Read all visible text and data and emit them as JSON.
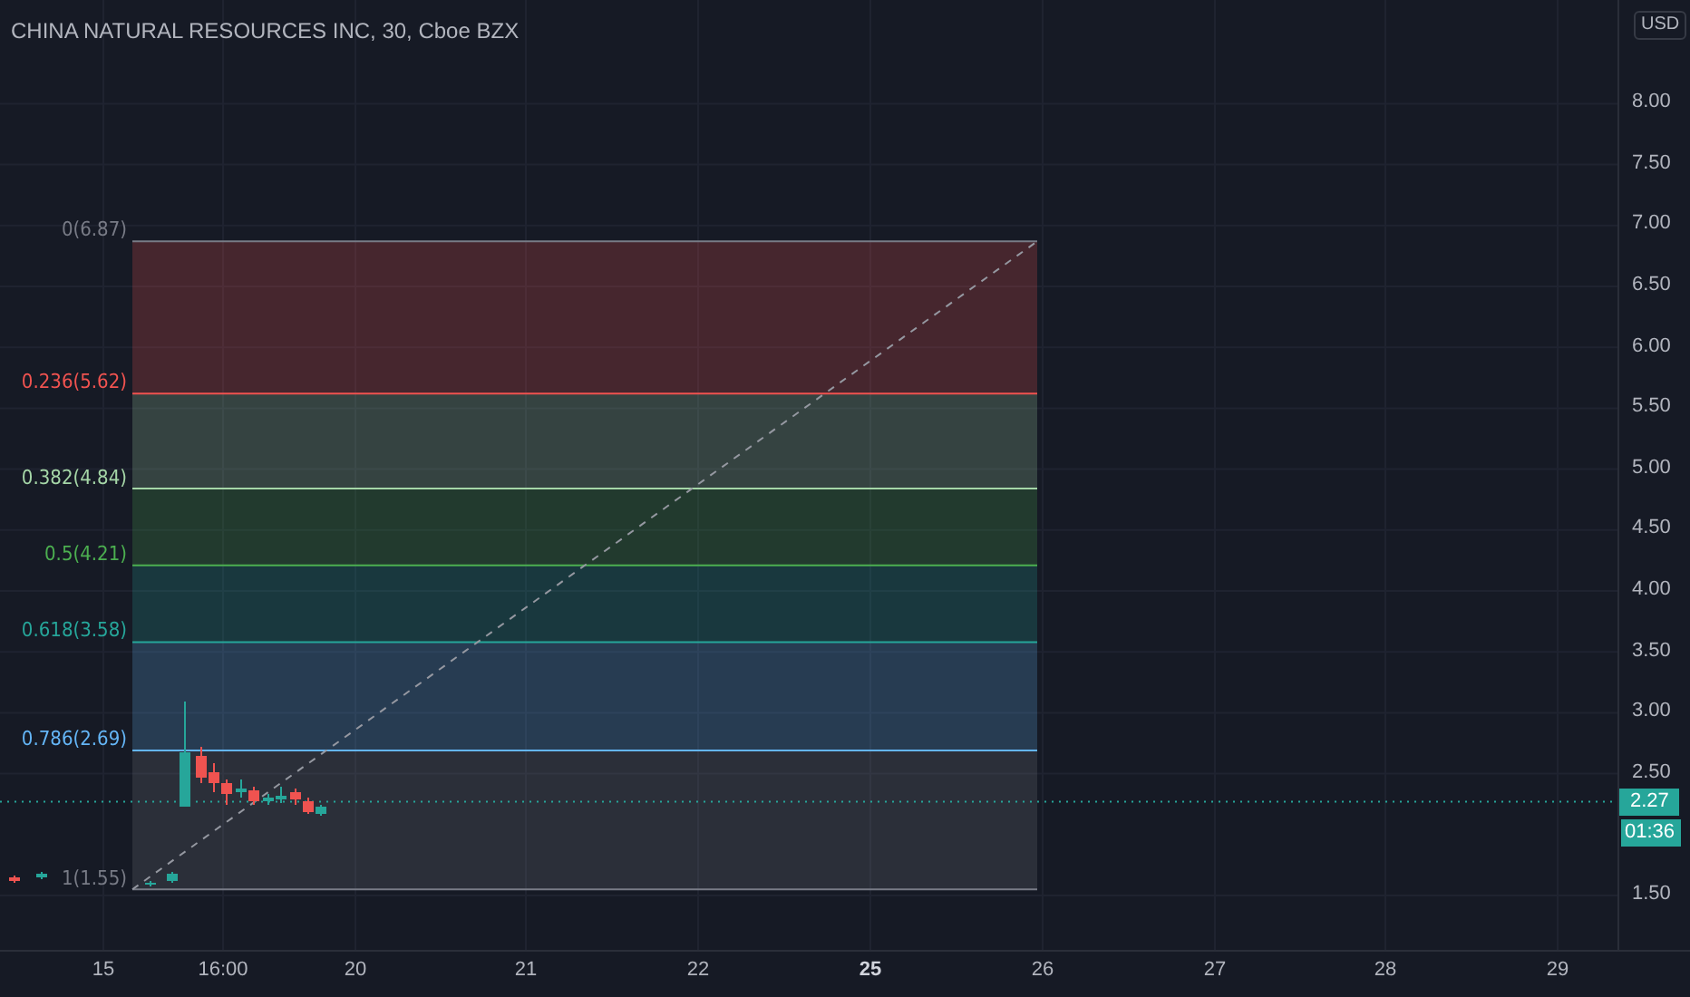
{
  "header": {
    "title": "CHINA NATURAL RESOURCES INC, 30, Cboe BZX"
  },
  "currency_button": {
    "label": "USD"
  },
  "price_axis": {
    "ticks": [
      "8.00",
      "7.50",
      "7.00",
      "6.50",
      "6.00",
      "5.50",
      "5.00",
      "4.50",
      "4.00",
      "3.50",
      "3.00",
      "2.50",
      "1.50"
    ]
  },
  "price_marker": {
    "last_price": "2.27",
    "countdown": "01:36"
  },
  "time_axis": {
    "ticks": [
      {
        "label": "15",
        "bold": false
      },
      {
        "label": "16:00",
        "bold": false
      },
      {
        "label": "20",
        "bold": false
      },
      {
        "label": "21",
        "bold": false
      },
      {
        "label": "22",
        "bold": false
      },
      {
        "label": "25",
        "bold": true
      },
      {
        "label": "26",
        "bold": false
      },
      {
        "label": "27",
        "bold": false
      },
      {
        "label": "28",
        "bold": false
      },
      {
        "label": "29",
        "bold": false
      }
    ]
  },
  "fib_levels": [
    {
      "label": "0(6.87)",
      "color": "#787b86"
    },
    {
      "label": "0.236(5.62)",
      "color": "#f05350"
    },
    {
      "label": "0.382(4.84)",
      "color": "#a5d6a7"
    },
    {
      "label": "0.5(4.21)",
      "color": "#4caf50"
    },
    {
      "label": "0.618(3.58)",
      "color": "#26a69a"
    },
    {
      "label": "0.786(2.69)",
      "color": "#64b5f6"
    },
    {
      "label": "1(1.55)",
      "color": "#787b86"
    }
  ]
}
